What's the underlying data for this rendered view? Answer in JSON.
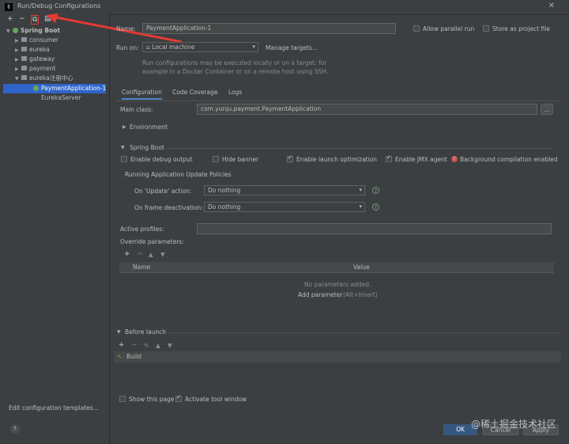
{
  "window": {
    "title": "Run/Debug Configurations",
    "logo_text": "IJ"
  },
  "left": {
    "toolbar": [
      "+",
      "−",
      "⧉",
      "▤"
    ],
    "tree": {
      "root": "Spring Boot",
      "items": [
        {
          "label": "consumer",
          "type": "folder",
          "expanded": false
        },
        {
          "label": "eureka",
          "type": "folder",
          "expanded": false
        },
        {
          "label": "gateway",
          "type": "folder",
          "expanded": false
        },
        {
          "label": "payment",
          "type": "folder",
          "expanded": false
        },
        {
          "label": "eureka注册中心",
          "type": "folder",
          "expanded": true
        },
        {
          "label": "PaymentApplication-1",
          "type": "config",
          "selected": true
        },
        {
          "label": "EurekaServer",
          "type": "config",
          "selected": false
        }
      ]
    },
    "edit_templates": "Edit configuration templates...",
    "help": "?"
  },
  "form": {
    "name_label": "Name:",
    "name_value": "PaymentApplication-1",
    "allow_parallel": "Allow parallel run",
    "store_as_project": "Store as project file",
    "run_on_label": "Run on:",
    "run_on_value": "Local machine",
    "manage_targets": "Manage targets...",
    "run_on_hint_1": "Run configurations may be executed locally or on a target: for",
    "run_on_hint_2": "example in a Docker Container or on a remote host using SSH.",
    "tabs": [
      "Configuration",
      "Code Coverage",
      "Logs"
    ],
    "main_class_label": "Main class:",
    "main_class_value": "com.yunju.payment.PaymentApplication",
    "environment": "Environment",
    "spring_boot": "Spring Boot",
    "enable_debug": "Enable debug output",
    "hide_banner": "Hide banner",
    "enable_launch_opt": "Enable launch optimization",
    "enable_jmx": "Enable JMX agent",
    "bg_compile": "Background compilation enabled",
    "update_policies": "Running Application Update Policies",
    "on_update_label": "On 'Update' action:",
    "on_update_value": "Do nothing",
    "on_frame_label": "On frame deactivation:",
    "on_frame_value": "Do nothing",
    "active_profiles": "Active profiles:",
    "override_params": "Override parameters:",
    "table_tools": [
      "+",
      "−",
      "▲",
      "▼"
    ],
    "col_name": "Name",
    "col_value": "Value",
    "no_params": "No parameters added.",
    "add_param": "Add parameter",
    "add_param_shortcut": "(Alt+Insert)",
    "before_launch": "Before launch",
    "launch_tools": [
      "+",
      "−",
      "✎",
      "▲",
      "▼"
    ],
    "build": "Build",
    "show_page": "Show this page",
    "activate_tool": "Activate tool window"
  },
  "buttons": {
    "ok": "OK",
    "cancel": "Cancel",
    "apply": "Apply"
  },
  "watermark": "@稀土掘金技术社区",
  "colors": {
    "background": "#3c3f41",
    "selection": "#2f65ca",
    "link": "#589df6",
    "annotation_red": "#e53935"
  }
}
